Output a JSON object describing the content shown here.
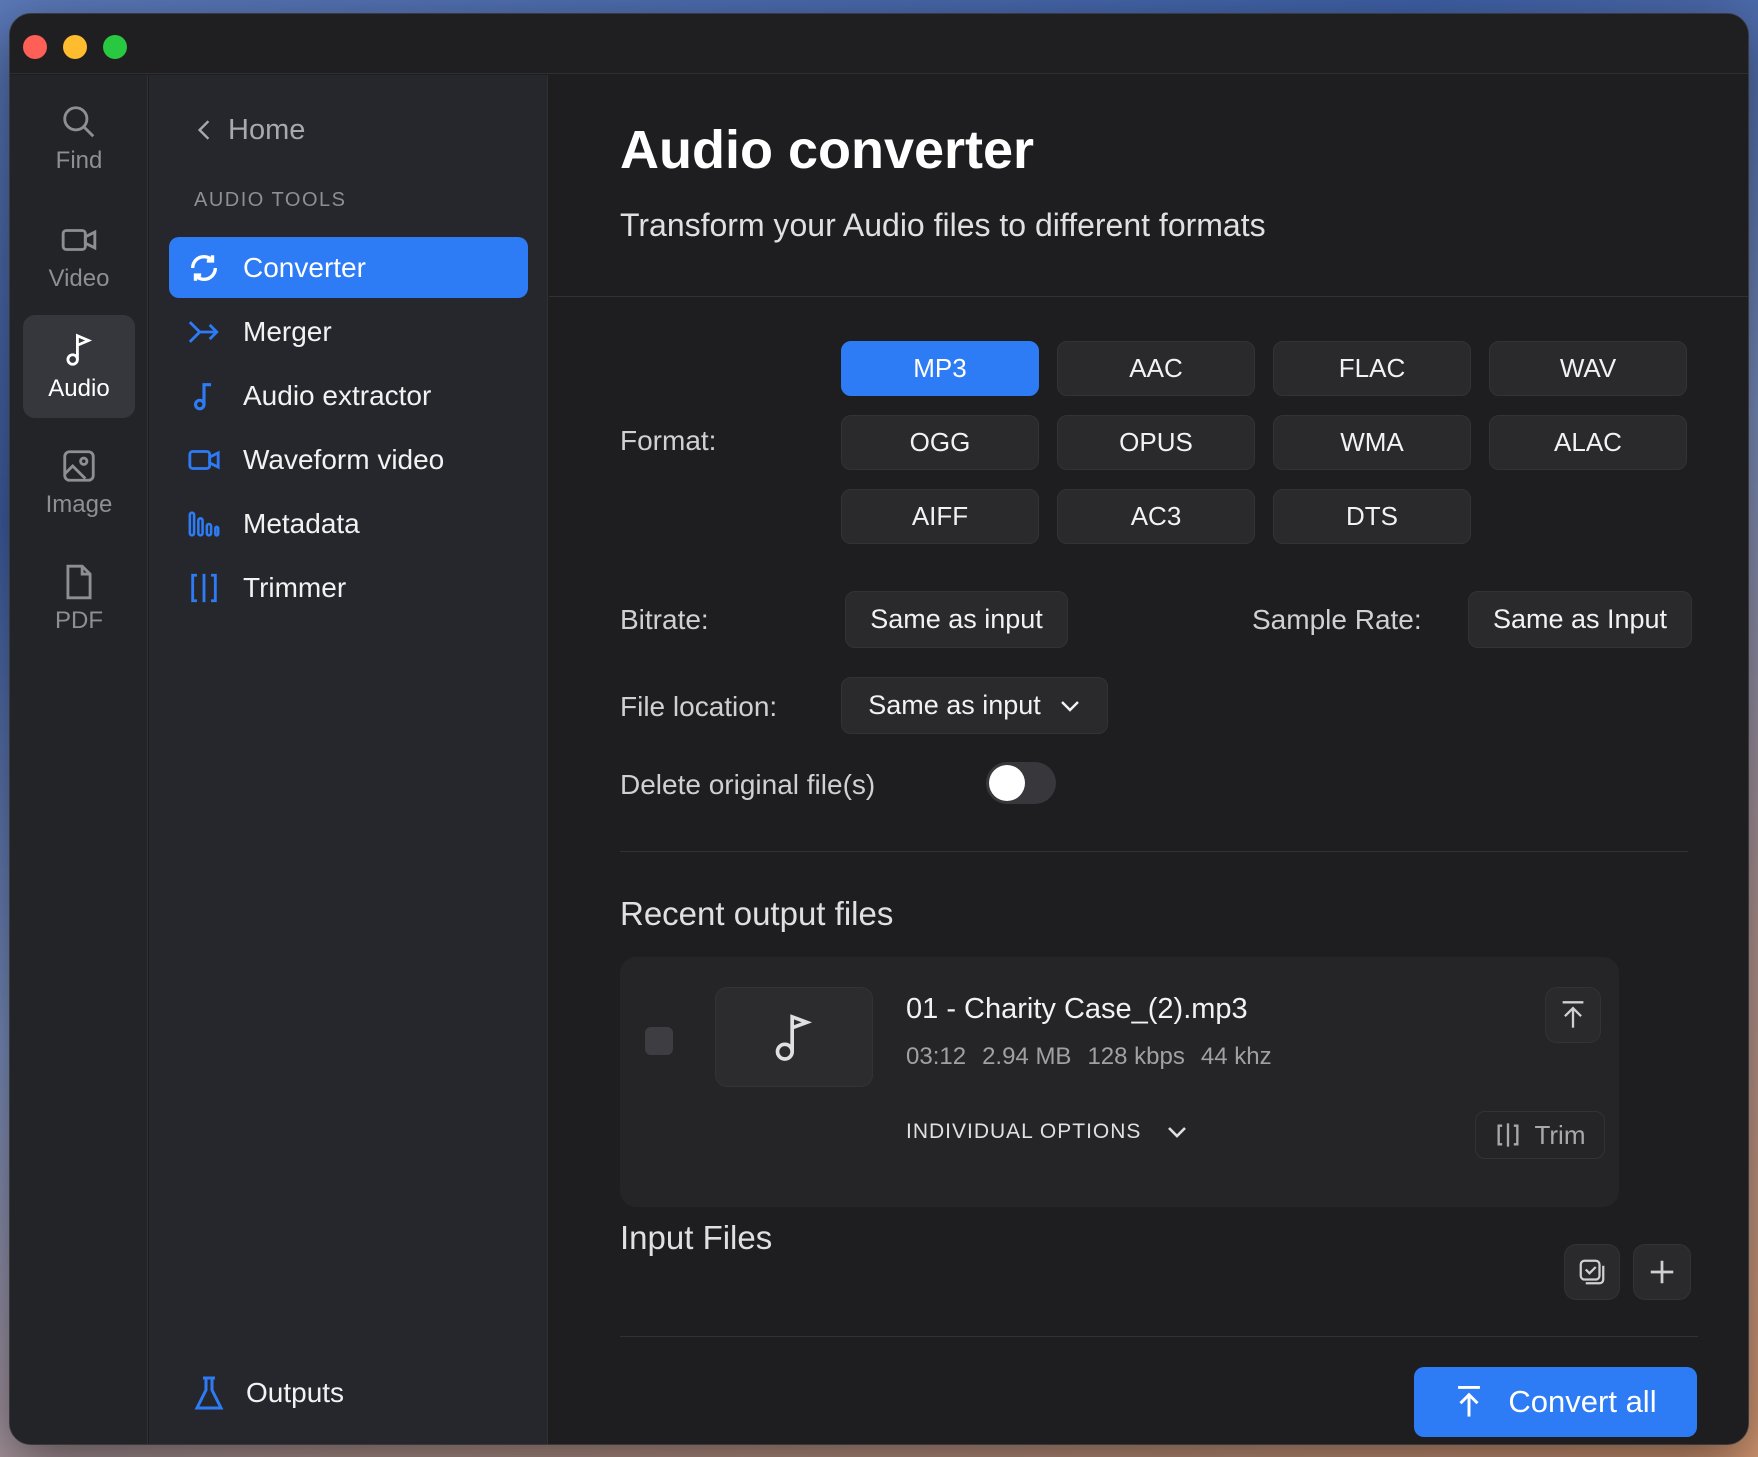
{
  "rail": {
    "items": [
      {
        "label": "Find",
        "icon": "search-icon"
      },
      {
        "label": "Video",
        "icon": "video-icon"
      },
      {
        "label": "Audio",
        "icon": "music-note-icon",
        "active": true
      },
      {
        "label": "Image",
        "icon": "image-icon"
      },
      {
        "label": "PDF",
        "icon": "document-icon"
      }
    ]
  },
  "sidebar": {
    "back_label": "Home",
    "section_label": "AUDIO TOOLS",
    "items": [
      {
        "label": "Converter",
        "icon": "refresh-icon",
        "active": true
      },
      {
        "label": "Merger",
        "icon": "merge-icon"
      },
      {
        "label": "Audio extractor",
        "icon": "music-note-icon"
      },
      {
        "label": "Waveform video",
        "icon": "video-icon"
      },
      {
        "label": "Metadata",
        "icon": "bars-icon"
      },
      {
        "label": "Trimmer",
        "icon": "trim-icon"
      }
    ],
    "outputs_label": "Outputs"
  },
  "main": {
    "title": "Audio converter",
    "subtitle": "Transform your Audio files to different formats",
    "format_label": "Format:",
    "formats": [
      "MP3",
      "AAC",
      "FLAC",
      "WAV",
      "OGG",
      "OPUS",
      "WMA",
      "ALAC",
      "AIFF",
      "AC3",
      "DTS"
    ],
    "selected_format": "MP3",
    "bitrate_label": "Bitrate:",
    "bitrate_value": "Same as input",
    "sample_rate_label": "Sample Rate:",
    "sample_rate_value": "Same as Input",
    "file_location_label": "File location:",
    "file_location_value": "Same as input",
    "delete_original_label": "Delete original file(s)",
    "delete_original_on": false,
    "recent_title": "Recent output files",
    "recent_file": {
      "name": "01 - Charity Case_(2).mp3",
      "duration": "03:12",
      "size": "2.94 MB",
      "bitrate": "128 kbps",
      "sample_rate": "44 khz",
      "options_label": "INDIVIDUAL OPTIONS",
      "trim_label": "Trim"
    },
    "input_title": "Input Files",
    "convert_label": "Convert all"
  },
  "colors": {
    "accent": "#2e7bf6",
    "window_bg": "#1e1e20",
    "sidebar_bg": "#25272c"
  }
}
